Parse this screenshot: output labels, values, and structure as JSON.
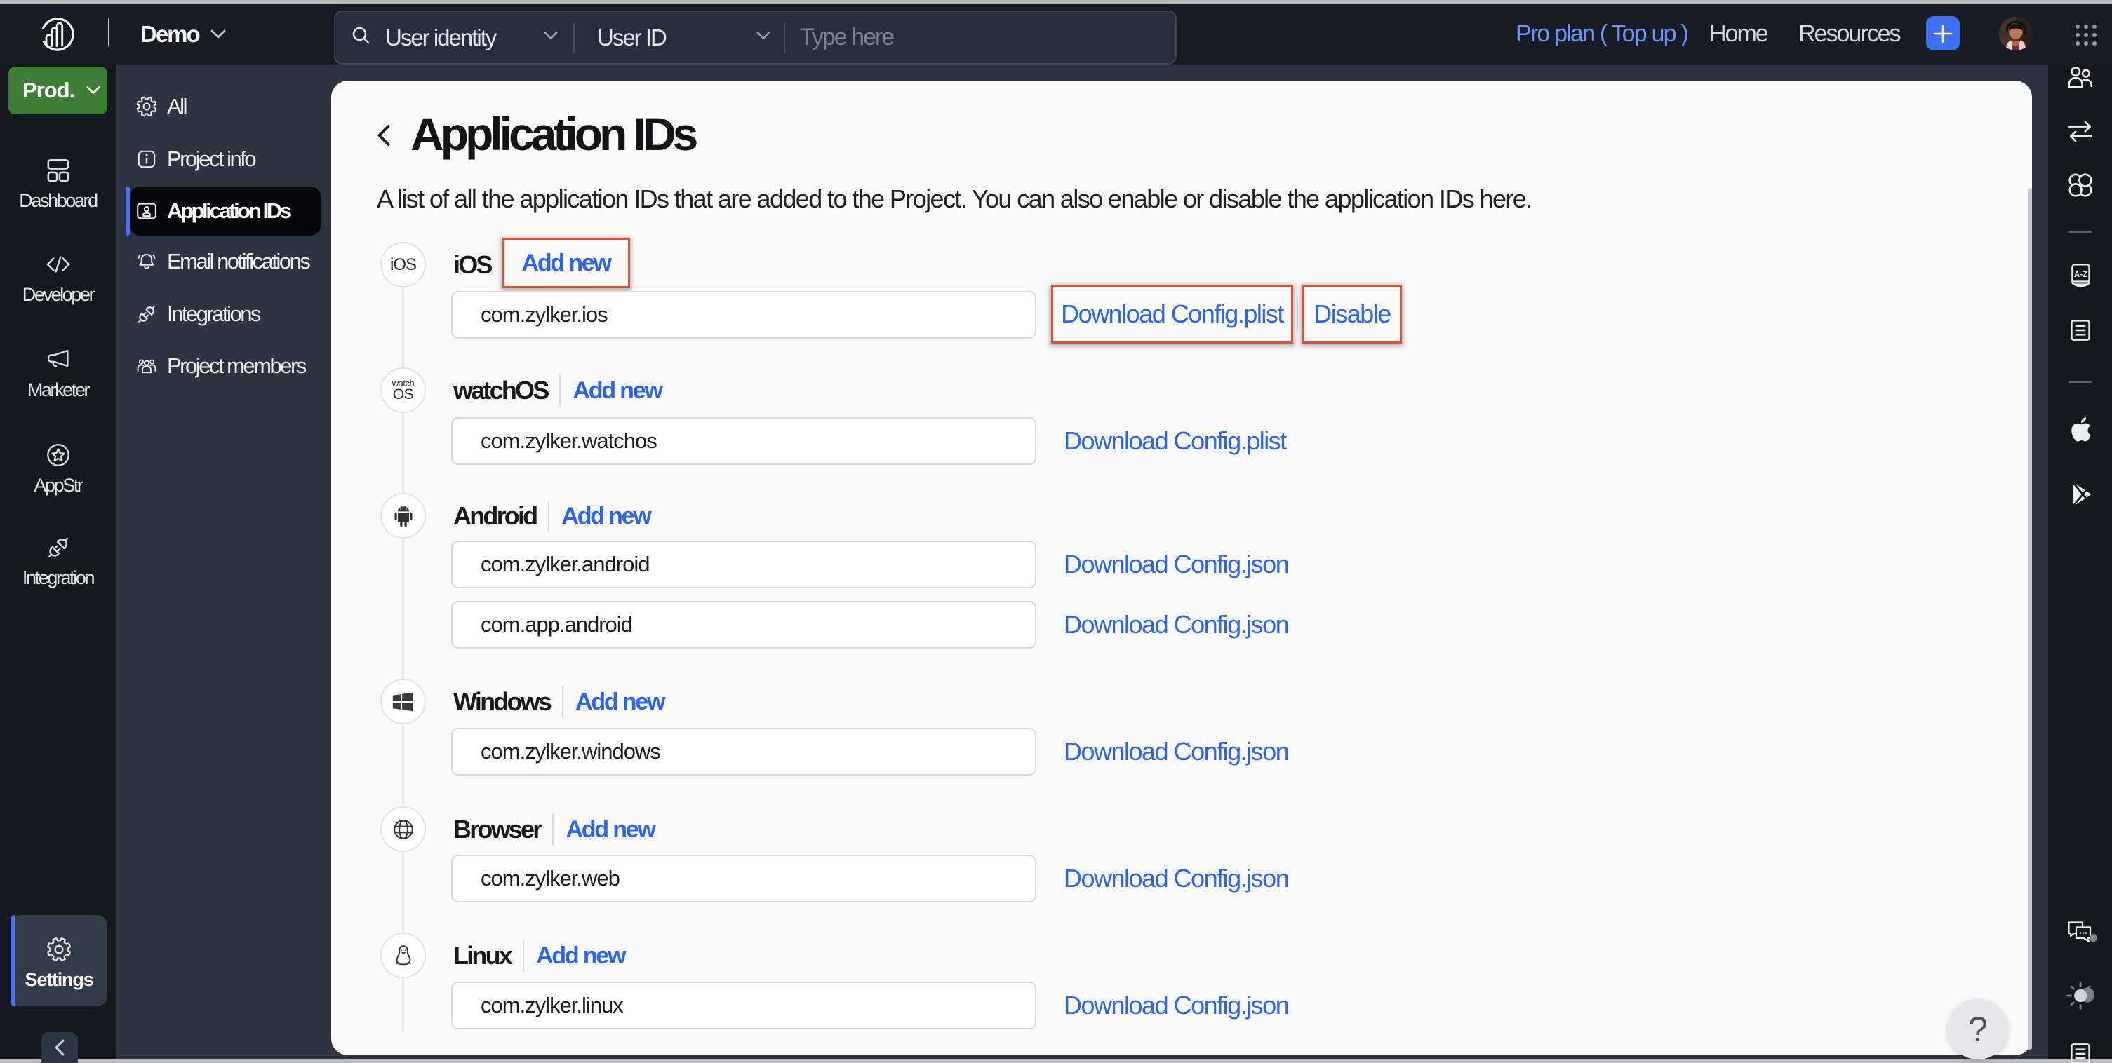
{
  "topbar": {
    "project_name": "Demo",
    "search": {
      "category": "User identity",
      "field": "User ID",
      "placeholder": "Type here"
    },
    "plan_label": "Pro plan ( Top up )",
    "home_label": "Home",
    "resources_label": "Resources",
    "add_label": "+"
  },
  "left_rail": {
    "env_label": "Prod.",
    "items": [
      {
        "label": "Dashboard"
      },
      {
        "label": "Developer"
      },
      {
        "label": "Marketer"
      },
      {
        "label": "AppStr"
      },
      {
        "label": "Integration"
      }
    ],
    "settings_label": "Settings"
  },
  "sidebar": {
    "items": [
      {
        "label": "All"
      },
      {
        "label": "Project info"
      },
      {
        "label": "Application IDs",
        "active": true
      },
      {
        "label": "Email notifications"
      },
      {
        "label": "Integrations"
      },
      {
        "label": "Project members"
      }
    ]
  },
  "main": {
    "title": "Application IDs",
    "description": "A list of all the application IDs that are added to the Project. You can also enable or disable the application IDs here.",
    "sections": [
      {
        "platform": "iOS",
        "badge": "iOS",
        "add_new": "Add new",
        "apps": [
          {
            "id": "com.zylker.ios",
            "download": "Download Config.plist",
            "disable": "Disable"
          }
        ]
      },
      {
        "platform": "watchOS",
        "badge_top": "watch",
        "badge_bottom": "OS",
        "add_new": "Add new",
        "apps": [
          {
            "id": "com.zylker.watchos",
            "download": "Download Config.plist"
          }
        ]
      },
      {
        "platform": "Android",
        "add_new": "Add new",
        "apps": [
          {
            "id": "com.zylker.android",
            "download": "Download Config.json"
          },
          {
            "id": "com.app.android",
            "download": "Download Config.json"
          }
        ]
      },
      {
        "platform": "Windows",
        "add_new": "Add new",
        "apps": [
          {
            "id": "com.zylker.windows",
            "download": "Download Config.json"
          }
        ]
      },
      {
        "platform": "Browser",
        "add_new": "Add new",
        "apps": [
          {
            "id": "com.zylker.web",
            "download": "Download Config.json"
          }
        ]
      },
      {
        "platform": "Linux",
        "add_new": "Add new",
        "apps": [
          {
            "id": "com.zylker.linux",
            "download": "Download Config.json"
          }
        ]
      }
    ],
    "help_label": "?"
  },
  "colors": {
    "topbar_bg": "#171c26",
    "rail_bg": "#14181f",
    "slate_bg": "#2b323f",
    "green_env": "#3d7d35",
    "accent_blue": "#3e6ff2",
    "link_blue": "#2d63f1",
    "annotation_red": "#e0503a",
    "panel_bg": "#fafafa",
    "active_black": "#060708"
  }
}
